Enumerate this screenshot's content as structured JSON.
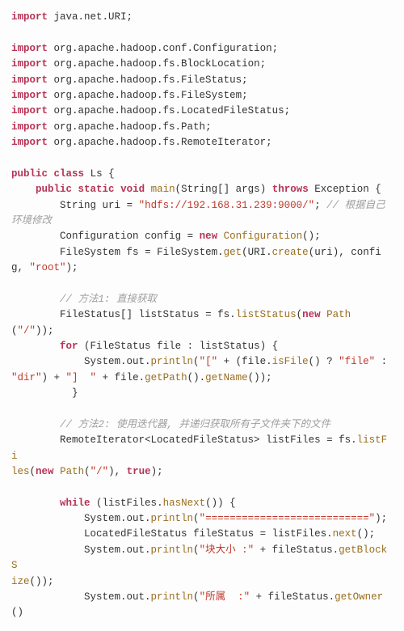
{
  "imports": {
    "i0": "java.net.URI",
    "i1": "org.apache.hadoop.conf.Configuration",
    "i2": "org.apache.hadoop.fs.BlockLocation",
    "i3": "org.apache.hadoop.fs.FileStatus",
    "i4": "org.apache.hadoop.fs.FileSystem",
    "i5": "org.apache.hadoop.fs.LocatedFileStatus",
    "i6": "org.apache.hadoop.fs.Path",
    "i7": "org.apache.hadoop.fs.RemoteIterator"
  },
  "kw": {
    "import": "import",
    "public": "public",
    "class": "class",
    "static": "static",
    "void": "void",
    "throws": "throws",
    "new": "new",
    "for": "for",
    "while": "while",
    "true": "true"
  },
  "types": {
    "cls": "Ls",
    "main": "main",
    "stringArr": "String[]",
    "string": "String",
    "exception": "Exception",
    "configuration": "Configuration",
    "filesystem": "FileSystem",
    "filestatusArr": "FileStatus[]",
    "filestatus": "FileStatus",
    "path": "Path",
    "remoteIterator": "RemoteIterator<LocatedFileStatus>",
    "locatedFileStatus": "LocatedFileStatus",
    "uri": "URI"
  },
  "vars": {
    "args": "args",
    "uri": "uri",
    "config": "config",
    "fs": "fs",
    "listStatus": "listStatus",
    "file": "file",
    "listFiles": "listFiles",
    "fileStatus": "fileStatus"
  },
  "methods": {
    "get": "get",
    "create": "create",
    "listStatus": "listStatus",
    "println": "println",
    "isFile": "isFile",
    "getPath": "getPath",
    "getName": "getName",
    "listFiles": "listFi\nles",
    "hasNext": "hasNext",
    "next": "next",
    "getBlockSize": "getBlockS\nize",
    "getOwner": "getOwner"
  },
  "sysout": "System.out.",
  "strings": {
    "hdfs": "\"hdfs://192.168.31.239:9000/\"",
    "root": "\"root\"",
    "slash": "\"/\"",
    "openBracket": "\"[\"",
    "fileLit": "\"file\"",
    "dirLit": "\"dir\"",
    "closeBracketSp": "\"]  \"",
    "eqline": "\"===========================\"",
    "blockSize": "\"块大小 :\"",
    "owner": "\"所属  :\""
  },
  "comments": {
    "envEdit": "// 根据自己环境修改",
    "method1": "// 方法1: 直接获取",
    "method2": "// 方法2: 使用迭代器, 并递归获取所有子文件夹下的文件"
  }
}
